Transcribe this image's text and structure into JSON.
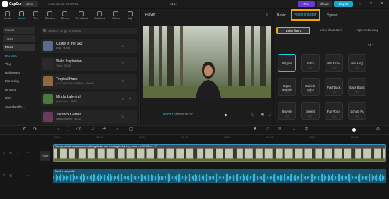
{
  "app": {
    "name": "CapCut",
    "menu_label": "Menu",
    "autosave": "Auto saved: 00:57:55",
    "doc_title": "1104"
  },
  "header": {
    "pro_label": "Pro",
    "share_label": "Share",
    "export_label": "Export"
  },
  "left_tabs": [
    {
      "label": "Media",
      "icon": "media-icon"
    },
    {
      "label": "Audio",
      "icon": "audio-icon"
    },
    {
      "label": "Text",
      "icon": "text-icon"
    },
    {
      "label": "Stickers",
      "icon": "sticker-icon"
    },
    {
      "label": "Effects",
      "icon": "effects-icon"
    },
    {
      "label": "Transitions",
      "icon": "transitions-icon"
    },
    {
      "label": "Captions",
      "icon": "captions-icon"
    },
    {
      "label": "Filters",
      "icon": "filters-icon"
    },
    {
      "label": "Adj",
      "icon": "adjust-icon"
    }
  ],
  "sidenav": {
    "import": "Import",
    "yours": "Yours",
    "music": "Music",
    "categories": [
      "Hot tags",
      "Vlog",
      "Halloween",
      "Marketing",
      "Dreamy",
      "Hits",
      "Sounds effe..."
    ]
  },
  "search": {
    "placeholder": "Search songs or artists"
  },
  "tracks": [
    {
      "name": "Castle in the Sky",
      "meta": "LVN · 00:45",
      "color": "#5b6b8c"
    },
    {
      "name": "Violin Inspiration",
      "meta": "Tony · 00:42",
      "color": "#2b2b2b"
    },
    {
      "name": "Tropical Haze",
      "meta": "ALEXANDER KAPROV · 00:50",
      "color": "#8c6a3b"
    },
    {
      "name": "Mind's Labyrinth",
      "meta": "Katie Vine · 02:00",
      "color": "#4a7a3b"
    },
    {
      "name": "Jukebox Games",
      "meta": "Sam Dmitrov · 02:00",
      "color": "#6b3b5b"
    }
  ],
  "player": {
    "title": "Player",
    "time_current": "00:00:10:13",
    "time_total": "00:00:16:17"
  },
  "right_panel": {
    "tabs": [
      "Basic",
      "Voice changer",
      "Speed"
    ],
    "subtabs": [
      "Voice filters",
      "Voice characters",
      "Speech to song"
    ],
    "all_label": "All",
    "effects": [
      "Original",
      "Echo",
      "Mic Echo",
      "Mic Hog",
      "Super Reverb",
      "Cubicle Echo",
      "Flashback",
      "Bass Boost",
      "Reverb",
      "Sweet",
      "Full Voice",
      "School PA"
    ]
  },
  "timeline": {
    "ruler": [
      "00:00",
      "00:05",
      "00:10",
      "00:15",
      "00:20",
      "00:25",
      "00:30",
      "00:35"
    ],
    "video_label": "Young mixed race woman walking forest and looking to the sky, close up   00:00:14:17",
    "audio_label": "Mind's Labyrinth",
    "cover_label": "Cover"
  },
  "colors": {
    "accent": "#2bc3e0",
    "highlight": "#f0a500",
    "pro": "#6a3ad0"
  }
}
